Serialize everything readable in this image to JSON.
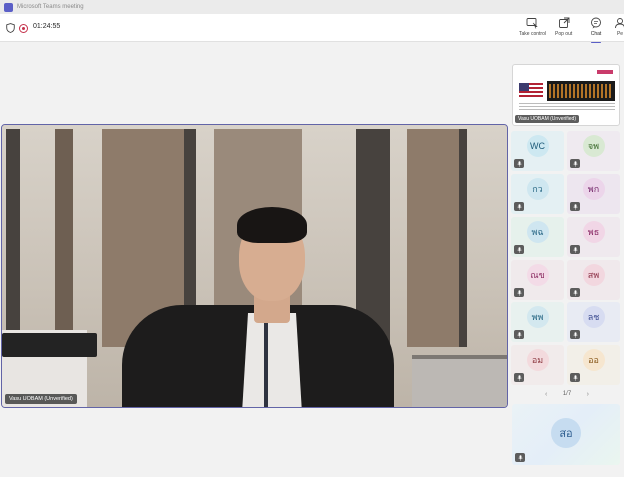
{
  "window": {
    "title": "Microsoft Teams meeting"
  },
  "topbar": {
    "timer": "01:24:55",
    "buttons": [
      {
        "label": "Take control",
        "icon": "take-control-icon"
      },
      {
        "label": "Pop out",
        "icon": "pop-out-icon"
      },
      {
        "label": "Chat",
        "icon": "chat-icon"
      },
      {
        "label": "Pe",
        "icon": "people-icon"
      }
    ]
  },
  "main_video": {
    "participant_name": "Vasu UOBAM (Unverified)"
  },
  "shared_content": {
    "participant_name": "Vasu UOBAM (Unverified)"
  },
  "participants": [
    {
      "initials": "WC",
      "avatar_bg": "#cde8f1",
      "text_color": "#1f5c7a",
      "tile_bg": "#e5f0f3"
    },
    {
      "initials": "จพ",
      "avatar_bg": "#d9e9d3",
      "text_color": "#3d6b2e",
      "tile_bg": "#efeaf0"
    },
    {
      "initials": "กว",
      "avatar_bg": "#cfe7f0",
      "text_color": "#2b6a86",
      "tile_bg": "#e4f0f3"
    },
    {
      "initials": "พก",
      "avatar_bg": "#ecd5ea",
      "text_color": "#7a2f70",
      "tile_bg": "#ede6ef"
    },
    {
      "initials": "พฉ",
      "avatar_bg": "#cfe6f0",
      "text_color": "#2d6a88",
      "tile_bg": "#e6f1ec"
    },
    {
      "initials": "พธ",
      "avatar_bg": "#f1d6e6",
      "text_color": "#8a2a66",
      "tile_bg": "#efe9ee"
    },
    {
      "initials": "ณข",
      "avatar_bg": "#f3dbe7",
      "text_color": "#8c2d62",
      "tile_bg": "#f0eaec"
    },
    {
      "initials": "สพ",
      "avatar_bg": "#f2d7df",
      "text_color": "#8b2f45",
      "tile_bg": "#f0e9ec"
    },
    {
      "initials": "พพ",
      "avatar_bg": "#d3e8ef",
      "text_color": "#2b6a86",
      "tile_bg": "#e8f1ef"
    },
    {
      "initials": "ลช",
      "avatar_bg": "#d7dcf1",
      "text_color": "#3b4a8f",
      "tile_bg": "#e8ebf3"
    },
    {
      "initials": "อม",
      "avatar_bg": "#f3dadd",
      "text_color": "#8f3b43",
      "tile_bg": "#f1ebeb"
    },
    {
      "initials": "ออ",
      "avatar_bg": "#f6e6cf",
      "text_color": "#8a5a1c",
      "tile_bg": "#f2efe8"
    }
  ],
  "pager": {
    "label": "1/7"
  },
  "featured_participant": {
    "initials": "สอ",
    "avatar_bg": "#c6dcf0",
    "text_color": "#2c5d8f"
  },
  "colors": {
    "accent": "#5b5fc7",
    "recording": "#c4314b"
  }
}
